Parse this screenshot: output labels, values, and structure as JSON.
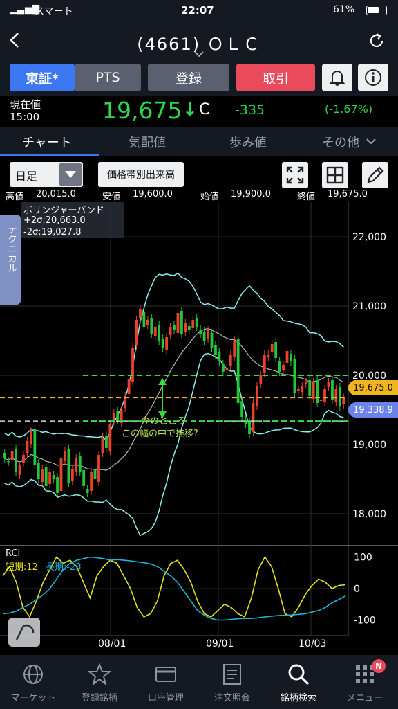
{
  "status_bar": {
    "carrier": "スマート",
    "time": "22:07",
    "battery": "61%"
  },
  "header": {
    "title": "(4661) ＯＬＣ"
  },
  "top_tabs": [
    {
      "label": "東証*"
    },
    {
      "label": "PTS"
    },
    {
      "label": "登録"
    },
    {
      "label": "取引"
    }
  ],
  "quote": {
    "label": "現在値",
    "time": "15:00",
    "price": "19,675",
    "arrow": "↓",
    "flag": "C",
    "change": "-335",
    "change_pct": "(-1.67%)"
  },
  "sub_tabs": [
    {
      "label": "チャート"
    },
    {
      "label": "気配値"
    },
    {
      "label": "歩み値"
    },
    {
      "label": "その他"
    }
  ],
  "tools": {
    "period": "日足",
    "volume_button": "価格帯別出来高"
  },
  "ohlc": {
    "high_label": "高値",
    "high": "20,015.0",
    "low_label": "安値",
    "low": "19,600.0",
    "open_label": "始値",
    "open": "19,900.0",
    "close_label": "終値",
    "close": "19,675.0"
  },
  "side_tab": "テクニカル",
  "indicator": {
    "name": "ボリンジャーバンド",
    "upper": "+2σ:20,663.0",
    "lower": "-2σ:19,027.8"
  },
  "annotation": {
    "line1": "今のところ",
    "line2": "この幅の中で推移?"
  },
  "price_tags": {
    "current": "19,675.0",
    "other": "19,338.9"
  },
  "rci": {
    "title": "RCI",
    "short": "短期:12",
    "long": "長期:-23"
  },
  "colors": {
    "up": "#e8412c",
    "down": "#23c53a",
    "band": "#8ef0ee",
    "ma": "#b8b8b8",
    "rci_short": "#e7e21b",
    "rci_long": "#21b4d6",
    "accent": "#3c76f0",
    "sell": "#e94b5d"
  },
  "chart_data": [
    {
      "type": "candlestick",
      "title": "ボリンジャーバンド",
      "y_ticks": [
        "22,000",
        "21,000",
        "20,000",
        "19,000",
        "18,000"
      ],
      "x_ticks": [
        "08/01",
        "09/01",
        "10/03"
      ],
      "ylim": [
        17600,
        22500
      ],
      "close_series": [
        18800,
        18750,
        18900,
        18600,
        18700,
        18850,
        19050,
        19200,
        18700,
        18500,
        18650,
        18400,
        18600,
        18500,
        18300,
        18800,
        18900,
        18450,
        18650,
        18800,
        18600,
        18400,
        18300,
        18600,
        18500,
        18850,
        19100,
        18950,
        19300,
        19450,
        19350,
        19500,
        19700,
        19950,
        20400,
        20800,
        20950,
        20700,
        20800,
        20600,
        20700,
        20500,
        20400,
        20550,
        20700,
        20650,
        20900,
        20600,
        20750,
        20650,
        20800,
        20700,
        20600,
        20500,
        20650,
        20400,
        20300,
        20200,
        20050,
        20100,
        20300,
        20500,
        19600,
        19400,
        19300,
        19150,
        19600,
        19850,
        20000,
        20300,
        20300,
        20450,
        20250,
        20050,
        20150,
        20350,
        20200,
        19750,
        19800,
        19850,
        19900,
        19700,
        19900,
        19600,
        19650,
        19800,
        19900,
        19650,
        19800,
        19550,
        19675
      ],
      "bollinger_upper": [
        20663
      ],
      "bollinger_lower": [
        19027.8
      ],
      "horizontal_lines": [
        20000,
        19675,
        19338.9
      ],
      "last_close": 19675
    },
    {
      "type": "line",
      "title": "RCI",
      "y_ticks": [
        "100",
        "0",
        "-100"
      ],
      "ylim": [
        -110,
        110
      ],
      "series": [
        {
          "name": "短期:12",
          "values": [
            40,
            70,
            20,
            -60,
            -90,
            -40,
            20,
            60,
            100,
            80,
            90,
            70,
            20,
            -30,
            40,
            70,
            90,
            80,
            40,
            0,
            -60,
            -90,
            -80,
            -40,
            40,
            80,
            90,
            60,
            20,
            -40,
            -80,
            -90,
            -70,
            -50,
            -60,
            -80,
            -90,
            -30,
            60,
            100,
            70,
            0,
            -80,
            -90,
            -60,
            -20,
            10,
            30,
            20,
            0,
            10,
            12
          ]
        },
        {
          "name": "長期:-23",
          "values": [
            -80,
            -78,
            -72,
            -60,
            -50,
            -35,
            -20,
            0,
            30,
            60,
            80,
            90,
            95,
            100,
            98,
            95,
            90,
            92,
            90,
            88,
            85,
            82,
            78,
            70,
            55,
            40,
            20,
            -10,
            -40,
            -70,
            -85,
            -95,
            -100,
            -100,
            -98,
            -96,
            -95,
            -95,
            -93,
            -90,
            -88,
            -86,
            -85,
            -84,
            -82,
            -80,
            -75,
            -70,
            -60,
            -45,
            -35,
            -23
          ]
        }
      ]
    }
  ],
  "bottom_nav": [
    {
      "label": "マーケット",
      "icon": "globe-icon"
    },
    {
      "label": "登録銘柄",
      "icon": "star-icon"
    },
    {
      "label": "口座管理",
      "icon": "card-icon"
    },
    {
      "label": "注文照会",
      "icon": "document-icon"
    },
    {
      "label": "銘柄検索",
      "icon": "search-icon"
    },
    {
      "label": "メニュー",
      "icon": "grid-icon"
    }
  ],
  "menu_badge": "N"
}
